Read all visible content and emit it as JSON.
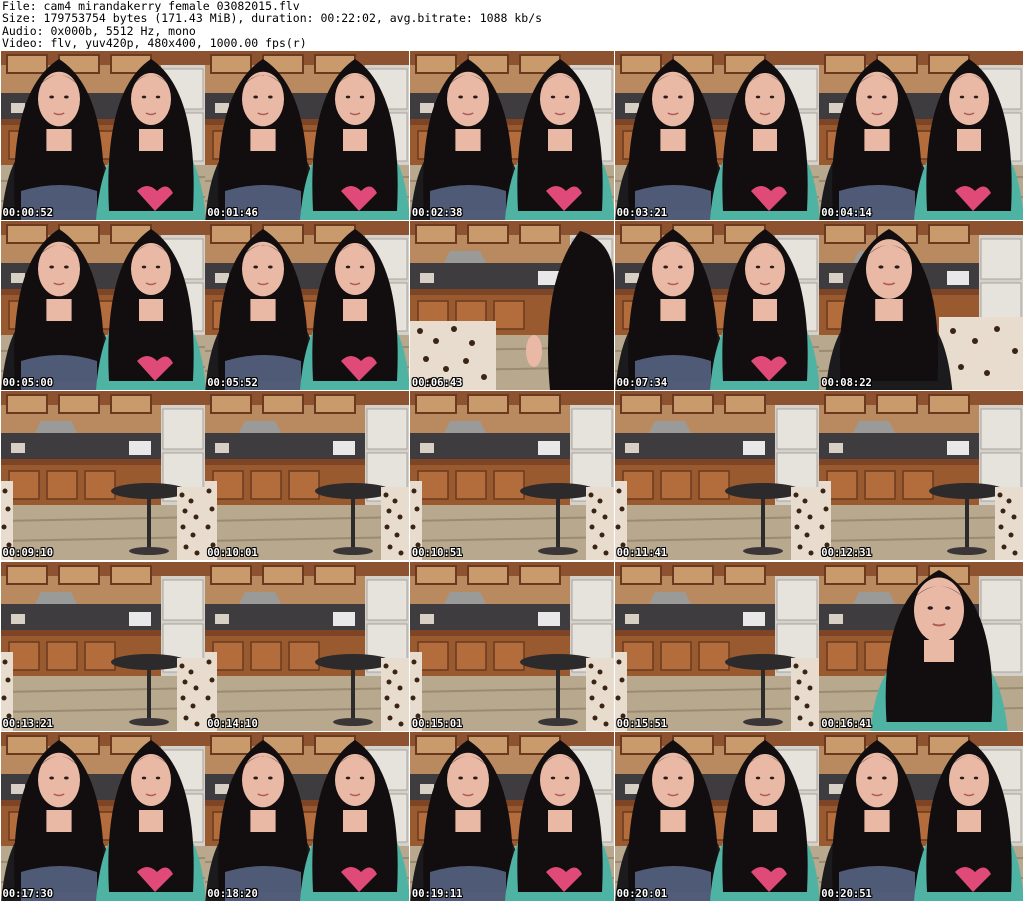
{
  "header": {
    "file_line": "File: cam4_mirandakerry_female_03082015.flv",
    "size_line": "Size: 179753754 bytes (171.43 MiB), duration: 00:22:02, avg.bitrate: 1088 kb/s",
    "audio_line": "Audio: 0x000b, 5512 Hz, mono",
    "video_line": "Video: flv, yuv420p, 480x400, 1000.00 fps(r)"
  },
  "thumbnails": [
    {
      "time": "00:00:52",
      "scene": "two"
    },
    {
      "time": "00:01:46",
      "scene": "two"
    },
    {
      "time": "00:02:38",
      "scene": "two"
    },
    {
      "time": "00:03:21",
      "scene": "two"
    },
    {
      "time": "00:04:14",
      "scene": "two"
    },
    {
      "time": "00:05:00",
      "scene": "two"
    },
    {
      "time": "00:05:52",
      "scene": "two"
    },
    {
      "time": "00:06:43",
      "scene": "room-hair"
    },
    {
      "time": "00:07:34",
      "scene": "two"
    },
    {
      "time": "00:08:22",
      "scene": "one-dark"
    },
    {
      "time": "00:09:10",
      "scene": "room"
    },
    {
      "time": "00:10:01",
      "scene": "room"
    },
    {
      "time": "00:10:51",
      "scene": "room"
    },
    {
      "time": "00:11:41",
      "scene": "room"
    },
    {
      "time": "00:12:31",
      "scene": "room"
    },
    {
      "time": "00:13:21",
      "scene": "room"
    },
    {
      "time": "00:14:10",
      "scene": "room"
    },
    {
      "time": "00:15:01",
      "scene": "room"
    },
    {
      "time": "00:15:51",
      "scene": "room"
    },
    {
      "time": "00:16:41",
      "scene": "one-teal"
    },
    {
      "time": "00:17:30",
      "scene": "two"
    },
    {
      "time": "00:18:20",
      "scene": "two"
    },
    {
      "time": "00:19:11",
      "scene": "two"
    },
    {
      "time": "00:20:01",
      "scene": "two"
    },
    {
      "time": "00:20:51",
      "scene": "two"
    }
  ],
  "colors": {
    "hair": "#120d0e",
    "skin": "#e9b9a6",
    "teal_shirt": "#4fb3a4",
    "black_shirt": "#1b1a1c",
    "cabinet": "#9a5a30",
    "wall": "#b98a60",
    "floor": "#b7a88e"
  }
}
